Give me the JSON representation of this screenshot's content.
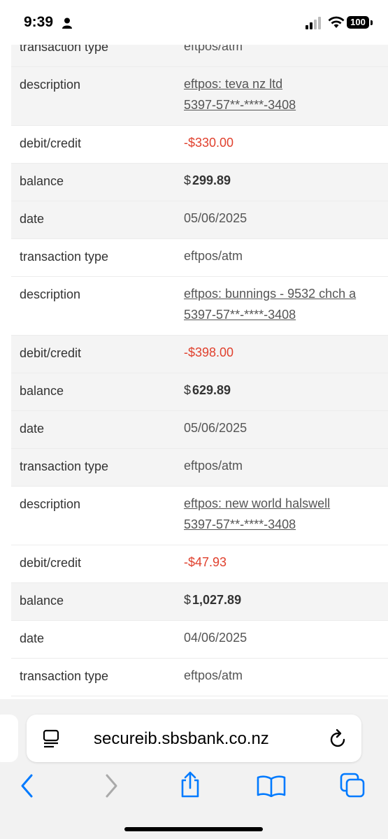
{
  "status_bar": {
    "time": "9:39",
    "battery": "100"
  },
  "rows": [
    {
      "label": "transaction type",
      "value": "eftpos/atm",
      "kind": "plain"
    },
    {
      "label": "description",
      "value": "eftpos: teva nz ltd",
      "value2": "5397-57**-****-3408",
      "kind": "link"
    },
    {
      "label": "debit/credit",
      "value": "-$330.00",
      "kind": "neg"
    },
    {
      "label": "balance",
      "value": "299.89",
      "kind": "bal"
    },
    {
      "label": "date",
      "value": "05/06/2025",
      "kind": "plain"
    },
    {
      "label": "transaction type",
      "value": "eftpos/atm",
      "kind": "plain"
    },
    {
      "label": "description",
      "value": "eftpos: bunnings - 9532 chch a",
      "value2": "5397-57**-****-3408",
      "kind": "link"
    },
    {
      "label": "debit/credit",
      "value": "-$398.00",
      "kind": "neg"
    },
    {
      "label": "balance",
      "value": "629.89",
      "kind": "bal"
    },
    {
      "label": "date",
      "value": "05/06/2025",
      "kind": "plain"
    },
    {
      "label": "transaction type",
      "value": "eftpos/atm",
      "kind": "plain"
    },
    {
      "label": "description",
      "value": "eftpos: new world halswell",
      "value2": "5397-57**-****-3408",
      "kind": "link"
    },
    {
      "label": "debit/credit",
      "value": "-$47.93",
      "kind": "neg"
    },
    {
      "label": "balance",
      "value": "1,027.89",
      "kind": "bal"
    },
    {
      "label": "date",
      "value": "04/06/2025",
      "kind": "plain"
    },
    {
      "label": "transaction type",
      "value": "eftpos/atm",
      "kind": "plain"
    }
  ],
  "currency_symbol": "$",
  "browser": {
    "url": "secureib.sbsbank.co.nz"
  },
  "colors": {
    "negative": "#e0412e",
    "shade": "#f4f4f4",
    "accent": "#007aff"
  }
}
